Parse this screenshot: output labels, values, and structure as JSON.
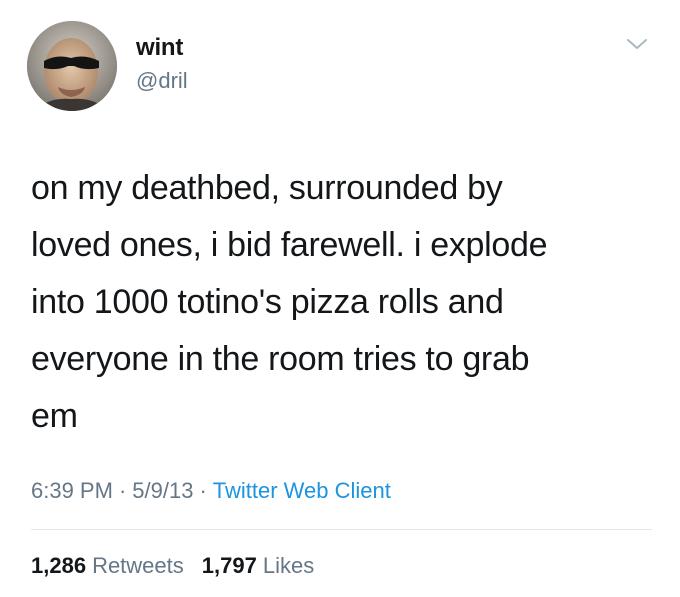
{
  "author": {
    "display_name": "wint",
    "handle": "@dril"
  },
  "tweet": {
    "text": "on my deathbed, surrounded by\nloved ones, i bid farewell. i explode\ninto 1000 totino's pizza rolls and\neveryone in the room tries to grab\nem",
    "time": "6:39 PM",
    "date": "5/9/13",
    "client": "Twitter Web Client",
    "separator": "·"
  },
  "stats": {
    "retweets_count": "1,286",
    "retweets_label": "Retweets",
    "likes_count": "1,797",
    "likes_label": "Likes"
  },
  "icons": {
    "menu": "chevron-down-icon"
  },
  "colors": {
    "text": "#14171a",
    "muted": "#657786",
    "link": "#1b95e0",
    "divider": "#e1e8ed"
  }
}
